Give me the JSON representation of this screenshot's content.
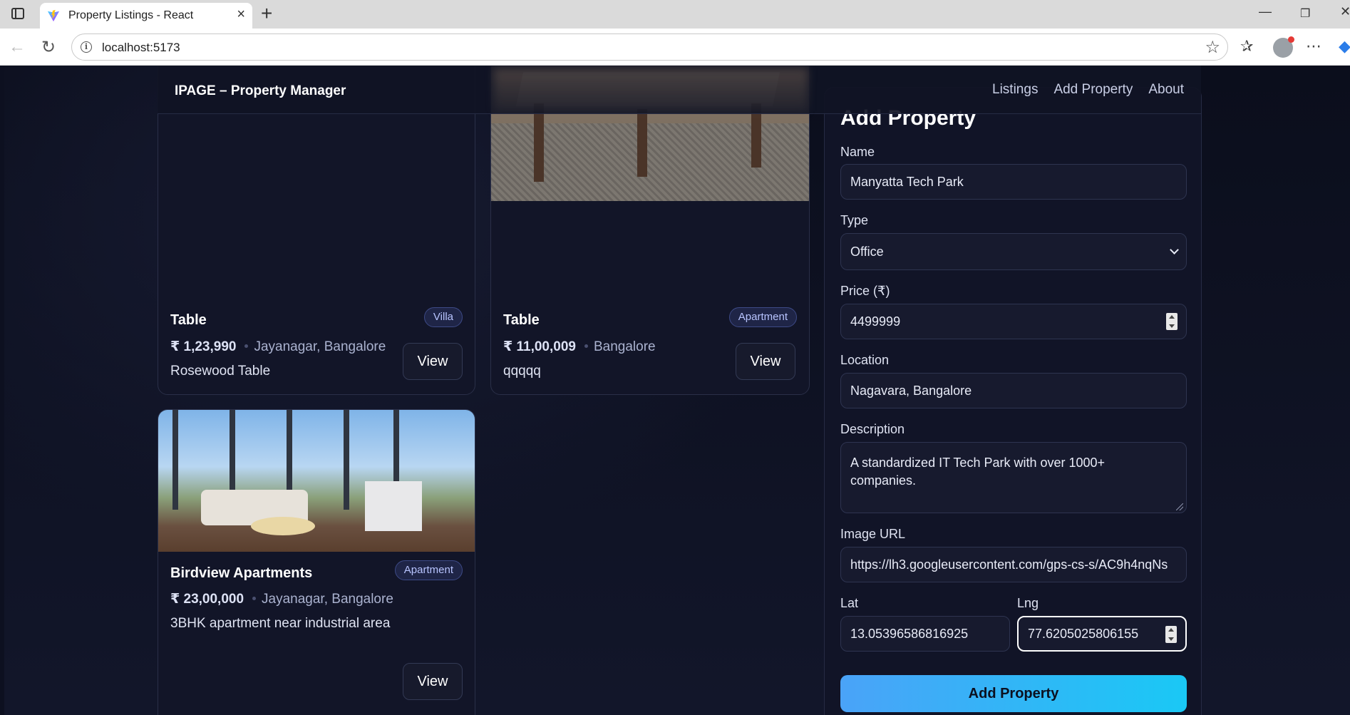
{
  "browser": {
    "tab_title": "Property Listings - React",
    "url": "localhost:5173"
  },
  "nav": {
    "brand": "IPAGE – Property Manager",
    "links": [
      "Listings",
      "Add Property",
      "About"
    ]
  },
  "listings": [
    {
      "title": "Table",
      "badge": "Villa",
      "price": "₹ 1,23,990",
      "location": "Jayanagar, Bangalore",
      "description": "Rosewood Table",
      "view_label": "View"
    },
    {
      "title": "Table",
      "badge": "Apartment",
      "price": "₹ 11,00,009",
      "location": "Bangalore",
      "description": "qqqqq",
      "view_label": "View"
    },
    {
      "title": "Birdview Apartments",
      "badge": "Apartment",
      "price": "₹ 23,00,000",
      "location": "Jayanagar, Bangalore",
      "description": "3BHK apartment near industrial area",
      "view_label": "View"
    }
  ],
  "form": {
    "heading": "Add Property",
    "name_label": "Name",
    "name_value": "Manyatta Tech Park",
    "type_label": "Type",
    "type_value": "Office",
    "price_label": "Price (₹)",
    "price_value": "4499999",
    "location_label": "Location",
    "location_value": "Nagavara, Bangalore",
    "description_label": "Description",
    "description_value": "A standardized IT Tech Park with over 1000+ companies.",
    "image_label": "Image URL",
    "image_value": "https://lh3.googleusercontent.com/gps-cs-s/AC9h4nqNs",
    "lat_label": "Lat",
    "lat_value": "13.05396586816925",
    "lng_label": "Lng",
    "lng_value": "77.6205025806155",
    "submit_label": "Add Property"
  }
}
